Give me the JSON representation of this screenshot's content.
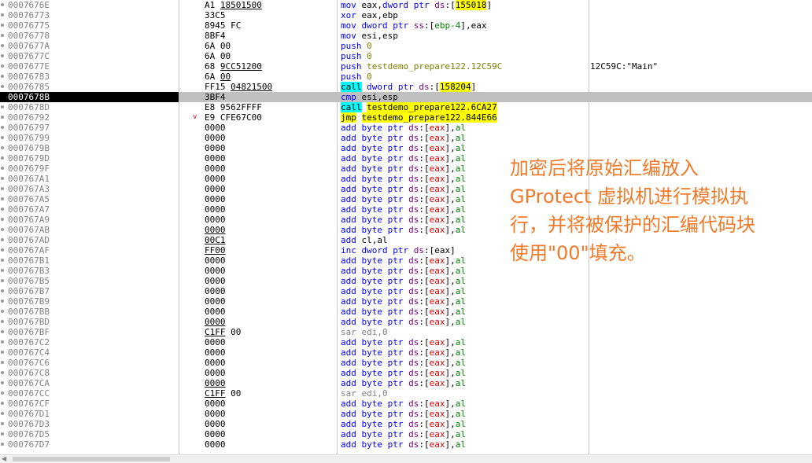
{
  "rows": [
    {
      "addr": "0007676E",
      "bytes": [
        {
          "t": "A1 "
        },
        {
          "t": "18501500",
          "c": "u"
        }
      ],
      "dis": [
        {
          "t": "mov",
          "c": "mn-blue"
        },
        {
          "t": " eax,"
        },
        {
          "t": "dword ptr",
          "c": "kw-blue"
        },
        {
          "t": " "
        },
        {
          "t": "ds",
          "c": "seg"
        },
        {
          "t": ":["
        },
        {
          "t": "155018",
          "c": "hly"
        },
        {
          "t": "]"
        }
      ]
    },
    {
      "addr": "00076773",
      "bytes": [
        {
          "t": "33C5"
        }
      ],
      "dis": [
        {
          "t": "xor",
          "c": "mn-blue"
        },
        {
          "t": " eax,ebp"
        }
      ]
    },
    {
      "addr": "00076775",
      "bytes": [
        {
          "t": "8945 FC"
        }
      ],
      "dis": [
        {
          "t": "mov",
          "c": "mn-blue"
        },
        {
          "t": " "
        },
        {
          "t": "dword ptr",
          "c": "kw-blue"
        },
        {
          "t": " "
        },
        {
          "t": "ss",
          "c": "seg"
        },
        {
          "t": ":["
        },
        {
          "t": "ebp-4",
          "c": "reg"
        },
        {
          "t": "],eax"
        }
      ]
    },
    {
      "addr": "00076778",
      "bytes": [
        {
          "t": "8BF4"
        }
      ],
      "dis": [
        {
          "t": "mov",
          "c": "mn-blue"
        },
        {
          "t": " esi,esp"
        }
      ]
    },
    {
      "addr": "0007677A",
      "bytes": [
        {
          "t": "6A 00"
        }
      ],
      "dis": [
        {
          "t": "push",
          "c": "mn-blue"
        },
        {
          "t": " "
        },
        {
          "t": "0",
          "c": "imm"
        }
      ]
    },
    {
      "addr": "0007677C",
      "bytes": [
        {
          "t": "6A 00"
        }
      ],
      "dis": [
        {
          "t": "push",
          "c": "mn-blue"
        },
        {
          "t": " "
        },
        {
          "t": "0",
          "c": "imm"
        }
      ]
    },
    {
      "addr": "0007677E",
      "bytes": [
        {
          "t": "68 "
        },
        {
          "t": "9CC51200",
          "c": "u"
        }
      ],
      "dis": [
        {
          "t": "push",
          "c": "mn-blue"
        },
        {
          "t": " "
        },
        {
          "t": "testdemo_prepare122.12C59C",
          "c": "imm"
        }
      ],
      "cmt": "12C59C:\"Main\""
    },
    {
      "addr": "00076783",
      "bytes": [
        {
          "t": "6A "
        },
        {
          "t": "00",
          "c": "u"
        }
      ],
      "dis": [
        {
          "t": "push",
          "c": "mn-blue"
        },
        {
          "t": " "
        },
        {
          "t": "0",
          "c": "imm"
        }
      ]
    },
    {
      "addr": "00076785",
      "bytes": [
        {
          "t": "FF15 "
        },
        {
          "t": "04821500",
          "c": "u"
        }
      ],
      "dis": [
        {
          "t": "call",
          "c": "hlc"
        },
        {
          "t": " "
        },
        {
          "t": "dword ptr",
          "c": "kw-blue"
        },
        {
          "t": " "
        },
        {
          "t": "ds",
          "c": "seg"
        },
        {
          "t": ":["
        },
        {
          "t": "158204",
          "c": "hly"
        },
        {
          "t": "]"
        }
      ]
    },
    {
      "addr": "0007678B",
      "sel": true,
      "bytes": [
        {
          "t": "3BF4"
        }
      ],
      "dis": [
        {
          "t": "cmp",
          "c": "mn-blue"
        },
        {
          "t": " esi,esp"
        }
      ]
    },
    {
      "addr": "0007678D",
      "bytes": [
        {
          "t": "E8 9562FFFF"
        }
      ],
      "dis": [
        {
          "t": "call",
          "c": "hlc"
        },
        {
          "t": " "
        },
        {
          "t": "testdemo_prepare122.6CA27",
          "c": "hly"
        }
      ]
    },
    {
      "addr": "00076792",
      "arrow": "v",
      "bytes": [
        {
          "t": "E9 CFE67C00"
        }
      ],
      "dis": [
        {
          "t": "jmp",
          "c": "hly"
        },
        {
          "t": " "
        },
        {
          "t": "testdemo_prepare122.844E66",
          "c": "hly"
        }
      ]
    },
    {
      "addr": "00076797",
      "bytes": [
        {
          "t": "0000"
        }
      ],
      "k": "add"
    },
    {
      "addr": "00076799",
      "bytes": [
        {
          "t": "0000"
        }
      ],
      "k": "add"
    },
    {
      "addr": "0007679B",
      "bytes": [
        {
          "t": "0000"
        }
      ],
      "k": "add"
    },
    {
      "addr": "0007679D",
      "bytes": [
        {
          "t": "0000"
        }
      ],
      "k": "add"
    },
    {
      "addr": "0007679F",
      "bytes": [
        {
          "t": "0000"
        }
      ],
      "k": "add"
    },
    {
      "addr": "000767A1",
      "bytes": [
        {
          "t": "0000"
        }
      ],
      "k": "add"
    },
    {
      "addr": "000767A3",
      "bytes": [
        {
          "t": "0000"
        }
      ],
      "k": "add"
    },
    {
      "addr": "000767A5",
      "bytes": [
        {
          "t": "0000"
        }
      ],
      "k": "add"
    },
    {
      "addr": "000767A7",
      "bytes": [
        {
          "t": "0000"
        }
      ],
      "k": "add"
    },
    {
      "addr": "000767A9",
      "bytes": [
        {
          "t": "0000"
        }
      ],
      "k": "add"
    },
    {
      "addr": "000767AB",
      "bytes": [
        {
          "t": "0000",
          "c": "u"
        }
      ],
      "k": "add"
    },
    {
      "addr": "000767AD",
      "bytes": [
        {
          "t": "00C1",
          "c": "u"
        }
      ],
      "dis": [
        {
          "t": "add",
          "c": "mn-blue"
        },
        {
          "t": " cl,al"
        }
      ]
    },
    {
      "addr": "000767AF",
      "bytes": [
        {
          "t": "FF00",
          "c": "u"
        }
      ],
      "dis": [
        {
          "t": "inc",
          "c": "mn-blue"
        },
        {
          "t": " "
        },
        {
          "t": "dword ptr",
          "c": "kw-blue"
        },
        {
          "t": " "
        },
        {
          "t": "ds",
          "c": "seg"
        },
        {
          "t": ":[eax]"
        }
      ]
    },
    {
      "addr": "000767B1",
      "bytes": [
        {
          "t": "0000"
        }
      ],
      "k": "add"
    },
    {
      "addr": "000767B3",
      "bytes": [
        {
          "t": "0000"
        }
      ],
      "k": "add"
    },
    {
      "addr": "000767B5",
      "bytes": [
        {
          "t": "0000"
        }
      ],
      "k": "add"
    },
    {
      "addr": "000767B7",
      "bytes": [
        {
          "t": "0000"
        }
      ],
      "k": "add"
    },
    {
      "addr": "000767B9",
      "bytes": [
        {
          "t": "0000"
        }
      ],
      "k": "add"
    },
    {
      "addr": "000767BB",
      "bytes": [
        {
          "t": "0000"
        }
      ],
      "k": "add"
    },
    {
      "addr": "000767BD",
      "bytes": [
        {
          "t": "0000",
          "c": "u"
        }
      ],
      "k": "add"
    },
    {
      "addr": "000767BF",
      "bytes": [
        {
          "t": "C1FF",
          "c": "u"
        },
        {
          "t": " 00"
        }
      ],
      "dis": [
        {
          "t": "sar",
          "c": "mn-gray"
        },
        {
          "t": " edi,0",
          "c": "mn-gray"
        }
      ]
    },
    {
      "addr": "000767C2",
      "bytes": [
        {
          "t": "0000"
        }
      ],
      "k": "add"
    },
    {
      "addr": "000767C4",
      "bytes": [
        {
          "t": "0000"
        }
      ],
      "k": "add"
    },
    {
      "addr": "000767C6",
      "bytes": [
        {
          "t": "0000"
        }
      ],
      "k": "add"
    },
    {
      "addr": "000767C8",
      "bytes": [
        {
          "t": "0000"
        }
      ],
      "k": "add"
    },
    {
      "addr": "000767CA",
      "bytes": [
        {
          "t": "0000",
          "c": "u"
        }
      ],
      "k": "add"
    },
    {
      "addr": "000767CC",
      "bytes": [
        {
          "t": "C1FF",
          "c": "u"
        },
        {
          "t": " 00"
        }
      ],
      "dis": [
        {
          "t": "sar",
          "c": "mn-gray"
        },
        {
          "t": " edi,0",
          "c": "mn-gray"
        }
      ]
    },
    {
      "addr": "000767CF",
      "bytes": [
        {
          "t": "0000"
        }
      ],
      "k": "add"
    },
    {
      "addr": "000767D1",
      "bytes": [
        {
          "t": "0000"
        }
      ],
      "k": "add"
    },
    {
      "addr": "000767D3",
      "bytes": [
        {
          "t": "0000"
        }
      ],
      "k": "add"
    },
    {
      "addr": "000767D5",
      "bytes": [
        {
          "t": "0000"
        }
      ],
      "k": "add"
    },
    {
      "addr": "000767D7",
      "bytes": [
        {
          "t": "0000"
        }
      ],
      "k": "add"
    }
  ],
  "add_template": [
    {
      "t": "add",
      "c": "mn-blue"
    },
    {
      "t": " "
    },
    {
      "t": "byte ptr",
      "c": "kw-blue"
    },
    {
      "t": " "
    },
    {
      "t": "ds",
      "c": "seg"
    },
    {
      "t": ":["
    },
    {
      "t": "eax",
      "c": "red"
    },
    {
      "t": "],"
    },
    {
      "t": "al",
      "c": "reg"
    }
  ],
  "overlay_lines": [
    "加密后将原始汇编放入",
    "GProtect 虚拟机进行模拟执",
    "行，并将被保护的汇编代码块",
    "使用\"00\"填充。"
  ],
  "colors": {
    "selected_row_bg": "#c0c0c0",
    "address_selected_bg": "#000000",
    "cyan_highlight": "#00ffff",
    "yellow_highlight": "#ffff00",
    "annotation": "#f07a2a"
  }
}
